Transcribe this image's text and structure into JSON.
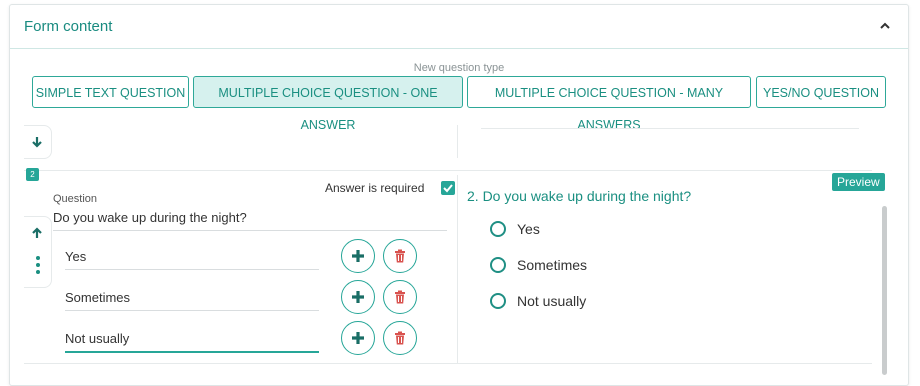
{
  "panel": {
    "title": "Form content",
    "collapse_icon": "chevron-up-icon"
  },
  "question_types": {
    "label": "New question type",
    "buttons": [
      {
        "label": "SIMPLE TEXT QUESTION",
        "active": false
      },
      {
        "label": "MULTIPLE CHOICE QUESTION - ONE ANSWER",
        "active": true
      },
      {
        "label": "MULTIPLE CHOICE QUESTION - MANY ANSWERS",
        "active": false
      },
      {
        "label": "YES/NO QUESTION",
        "active": false
      }
    ]
  },
  "question": {
    "number": "2",
    "required_label": "Answer is required",
    "required_checked": true,
    "field_label": "Question",
    "text": "Do you wake up during the night?",
    "answers": [
      "Yes",
      "Sometimes",
      "Not usually"
    ],
    "add_icon": "plus-icon",
    "delete_icon": "trash-icon"
  },
  "preview": {
    "badge": "Preview",
    "question": "2. Do you wake up during the night?",
    "options": [
      "Yes",
      "Sometimes",
      "Not usually"
    ]
  },
  "colors": {
    "accent": "#26a698",
    "delete": "#d9534f"
  }
}
